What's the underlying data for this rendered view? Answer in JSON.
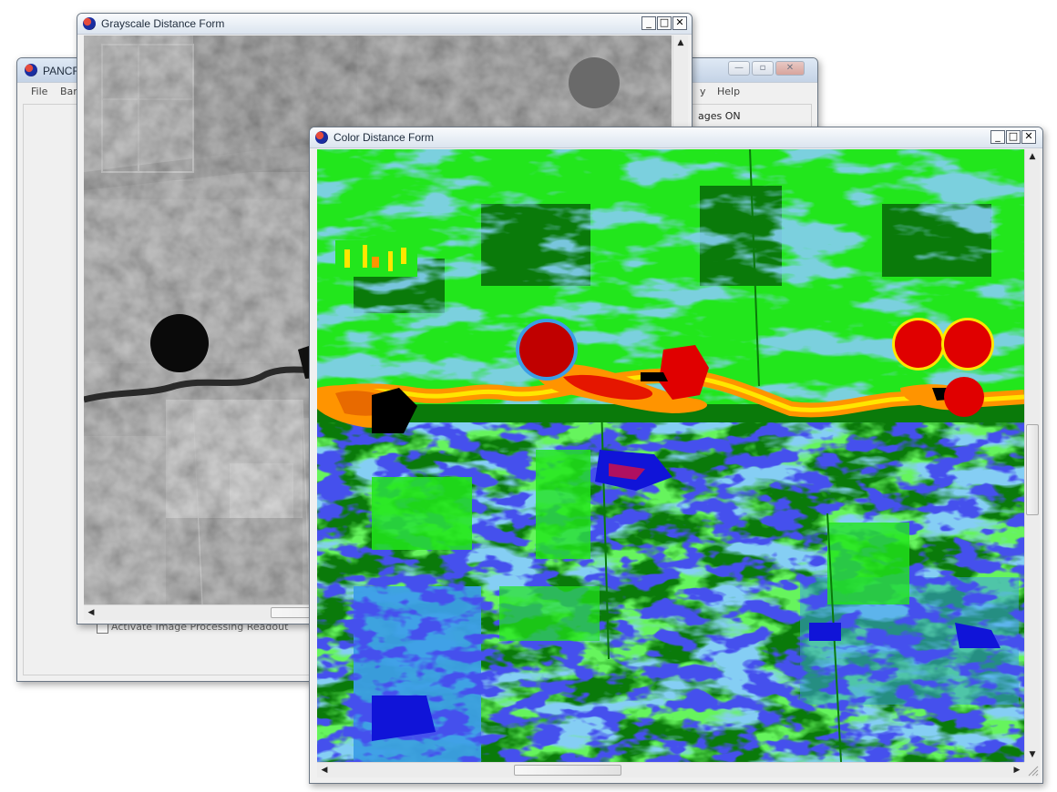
{
  "windows": {
    "panchromatic": {
      "title": "PANCR",
      "menu": {
        "file": "File",
        "band": "Ban",
        "display": "y",
        "help": "Help"
      },
      "status_text": "ages ON",
      "checkbox_label": "Activate Image Processing Readout"
    },
    "grayscale": {
      "title": "Grayscale Distance Form",
      "buttons": {
        "minimize": "_",
        "maximize": "□",
        "close": "✕"
      }
    },
    "color": {
      "title": "Color Distance Form",
      "buttons": {
        "minimize": "_",
        "maximize": "□",
        "close": "✕"
      }
    }
  },
  "icons": {
    "app": "app-icon",
    "scroll_up": "▲",
    "scroll_down": "▼",
    "scroll_left": "◀",
    "scroll_right": "▶"
  },
  "colors": {
    "dark_green": "#0a7a0a",
    "bright_green": "#22e61c",
    "light_blue": "#3c9ee6",
    "dark_blue": "#1014d8",
    "yellow": "#ffe600",
    "orange": "#ff9400",
    "red": "#e00000",
    "dark_red": "#c00000"
  }
}
